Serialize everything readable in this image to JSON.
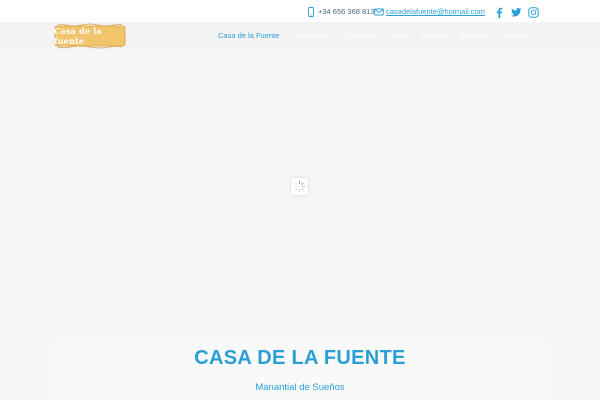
{
  "contact": {
    "phone": "+34 656 368 813",
    "email": "casadelafuente@hotmail.com"
  },
  "social": [
    {
      "icon": "facebook-icon"
    },
    {
      "icon": "twitter-icon"
    },
    {
      "icon": "instagram-icon"
    }
  ],
  "logo": {
    "text": "Casa de la fuente"
  },
  "nav": {
    "items": [
      {
        "label": "Casa de la Fuente",
        "active": true
      },
      {
        "label": "Alojamiento"
      },
      {
        "label": "Reservas"
      },
      {
        "label": "Blog"
      },
      {
        "label": "Galería"
      },
      {
        "label": "Entorno"
      },
      {
        "label": "Contacto"
      }
    ]
  },
  "hero": {
    "loader_icon": "loading-spinner-icon"
  },
  "card": {
    "title": "CASA DE LA FUENTE",
    "subtitle": "Manantial de Sueños"
  },
  "colors": {
    "accent": "#2a9fd6",
    "background": "#f6f6f6",
    "logo_scroll": "#f2c46c"
  }
}
